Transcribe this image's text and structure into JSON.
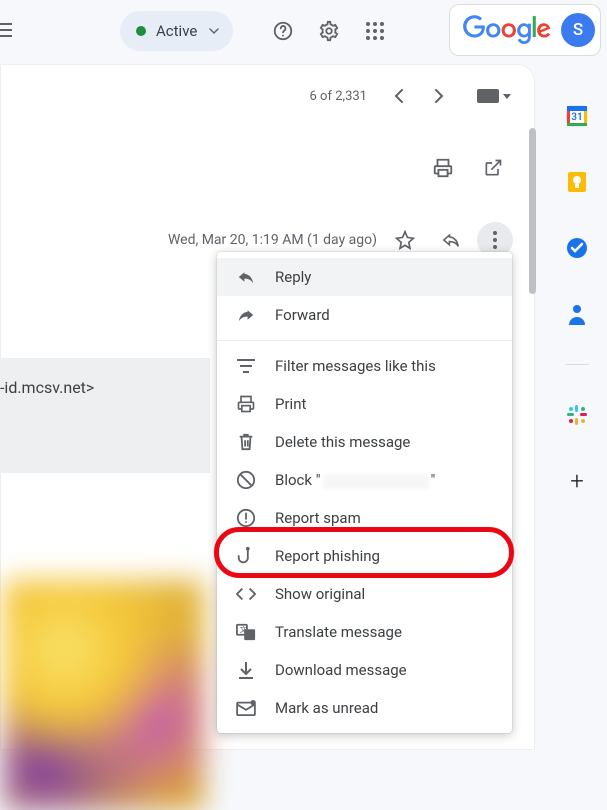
{
  "topbar": {
    "active_label": "Active",
    "google_word": "Google",
    "avatar_initial": "S"
  },
  "mail": {
    "counter": "6 of 2,331",
    "meta": "Wed, Mar 20, 1:19 AM (1 day ago)",
    "sender_domain": "-id.mcsv.net>"
  },
  "menu": [
    {
      "id": "reply",
      "label": "Reply"
    },
    {
      "id": "forward",
      "label": "Forward"
    },
    {
      "id": "separator"
    },
    {
      "id": "filter",
      "label": "Filter messages like this"
    },
    {
      "id": "print",
      "label": "Print"
    },
    {
      "id": "delete",
      "label": "Delete this message"
    },
    {
      "id": "block",
      "label_prefix": "Block \"",
      "label_suffix": "\""
    },
    {
      "id": "report-spam",
      "label": "Report spam"
    },
    {
      "id": "report-phishing",
      "label": "Report phishing"
    },
    {
      "id": "show-original",
      "label": "Show original"
    },
    {
      "id": "translate",
      "label": "Translate message"
    },
    {
      "id": "download",
      "label": "Download message"
    },
    {
      "id": "mark-unread",
      "label": "Mark as unread"
    }
  ],
  "highlighted_menu_id": "report-phishing",
  "side_panel": {
    "items": [
      "calendar",
      "keep",
      "tasks",
      "contacts"
    ],
    "has_separator": true,
    "extras": [
      "slack"
    ],
    "has_plus": true
  },
  "colors": {
    "highlight": "#eb0713",
    "avatar": "#3a7cf0",
    "active_dot": "#1e8e3e"
  }
}
